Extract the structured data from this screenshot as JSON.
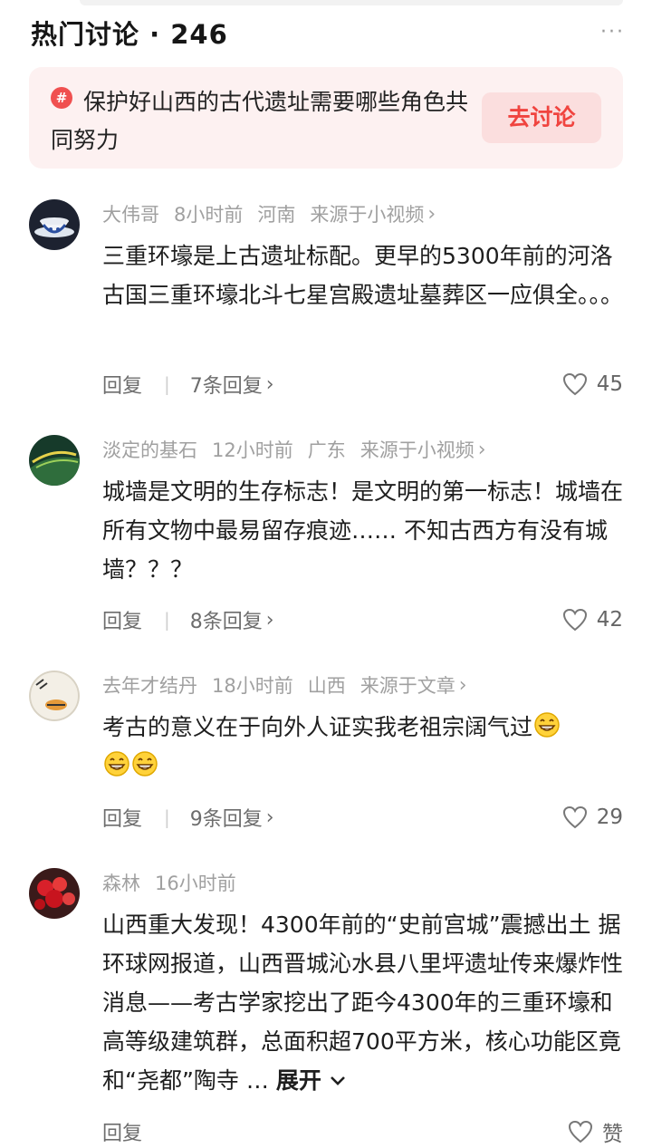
{
  "header": {
    "title": "热门讨论 · 246",
    "more_icon": "more-dots-icon"
  },
  "topic": {
    "icon": "hashtag-icon",
    "text": "保护好山西的古代遗址需要哪些角色共同努力",
    "button_label": "去讨论",
    "accent_color": "#f0443f"
  },
  "comments": [
    {
      "author": "大伟哥",
      "time": "8小时前",
      "location": "河南",
      "source": "来源于小视频",
      "text": "三重环壕是上古遗址标配。更早的5300年前的河洛古国三重环壕北斗七星宫殿遗址墓葬区一应俱全。。。",
      "reply_label": "回复",
      "replies": "7条回复",
      "likes": "45"
    },
    {
      "author": "淡定的基石",
      "time": "12小时前",
      "location": "广东",
      "source": "来源于小视频",
      "text": "城墙是文明的生存标志！是文明的第一标志！城墙在所有文物中最易留存痕迹…… 不知古西方有没有城墙？？？",
      "reply_label": "回复",
      "replies": "8条回复",
      "likes": "42"
    },
    {
      "author": "去年才结丹",
      "time": "18小时前",
      "location": "山西",
      "source": "来源于文章",
      "text": "考古的意义在于向外人证实我老祖宗阔气过",
      "reply_label": "回复",
      "replies": "9条回复",
      "likes": "29"
    },
    {
      "author": "森林",
      "time": "16小时前",
      "text": "山西重大发现！4300年前的“史前宫城”震撼出土 据环球网报道，山西晋城沁水县八里坪遗址传来爆炸性消息——考古学家挖出了距今4300年的三重环壕和高等级建筑群，总面积超700平方米，核心功能区竟和“尧都”陶寺 …",
      "expand_label": "展开",
      "reply_label": "回复",
      "like_label": "赞"
    }
  ]
}
